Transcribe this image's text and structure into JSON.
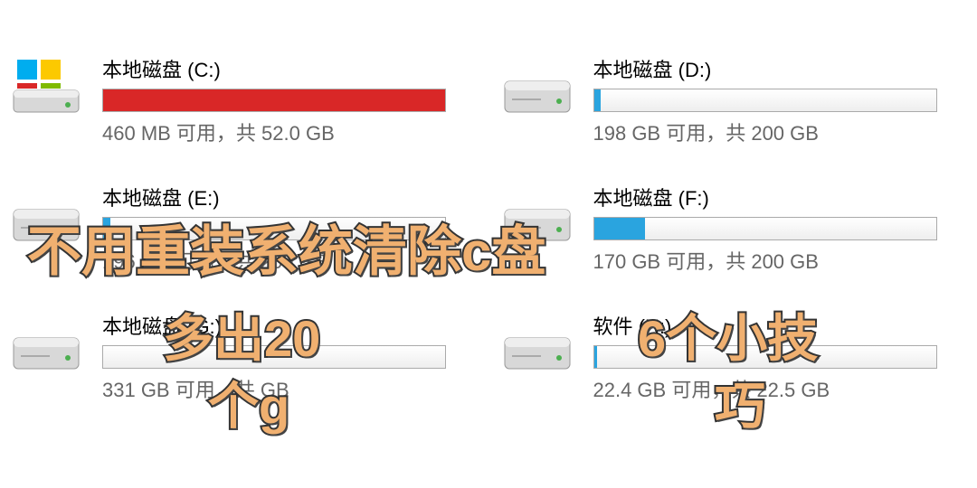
{
  "drives": [
    {
      "name": "本地磁盘 (C:)",
      "usage": "460 MB 可用，共 52.0 GB",
      "fill_percent": 100,
      "color": "red",
      "system": true
    },
    {
      "name": "本地磁盘 (D:)",
      "usage": "198 GB 可用，共 200 GB",
      "fill_percent": 2,
      "color": "blue",
      "system": false
    },
    {
      "name": "本地磁盘 (E:)",
      "usage": "196 GB 可用，共 200 GB",
      "fill_percent": 2,
      "color": "blue",
      "system": false
    },
    {
      "name": "本地磁盘 (F:)",
      "usage": "170 GB 可用，共 200 GB",
      "fill_percent": 15,
      "color": "blue",
      "system": false
    },
    {
      "name": "本地磁盘 (G:)",
      "usage": "331 GB 可用，共 GB",
      "fill_percent": 0,
      "color": "blue",
      "system": false
    },
    {
      "name": "软件 (H:)",
      "usage": "22.4 GB 可用，共 22.5 GB",
      "fill_percent": 1,
      "color": "blue",
      "system": false
    }
  ],
  "overlays": {
    "line1": "不用重装系统清除c盘",
    "line2a": "多出20",
    "line2b": "个g",
    "line3a": "6个小技",
    "line3b": "巧"
  }
}
